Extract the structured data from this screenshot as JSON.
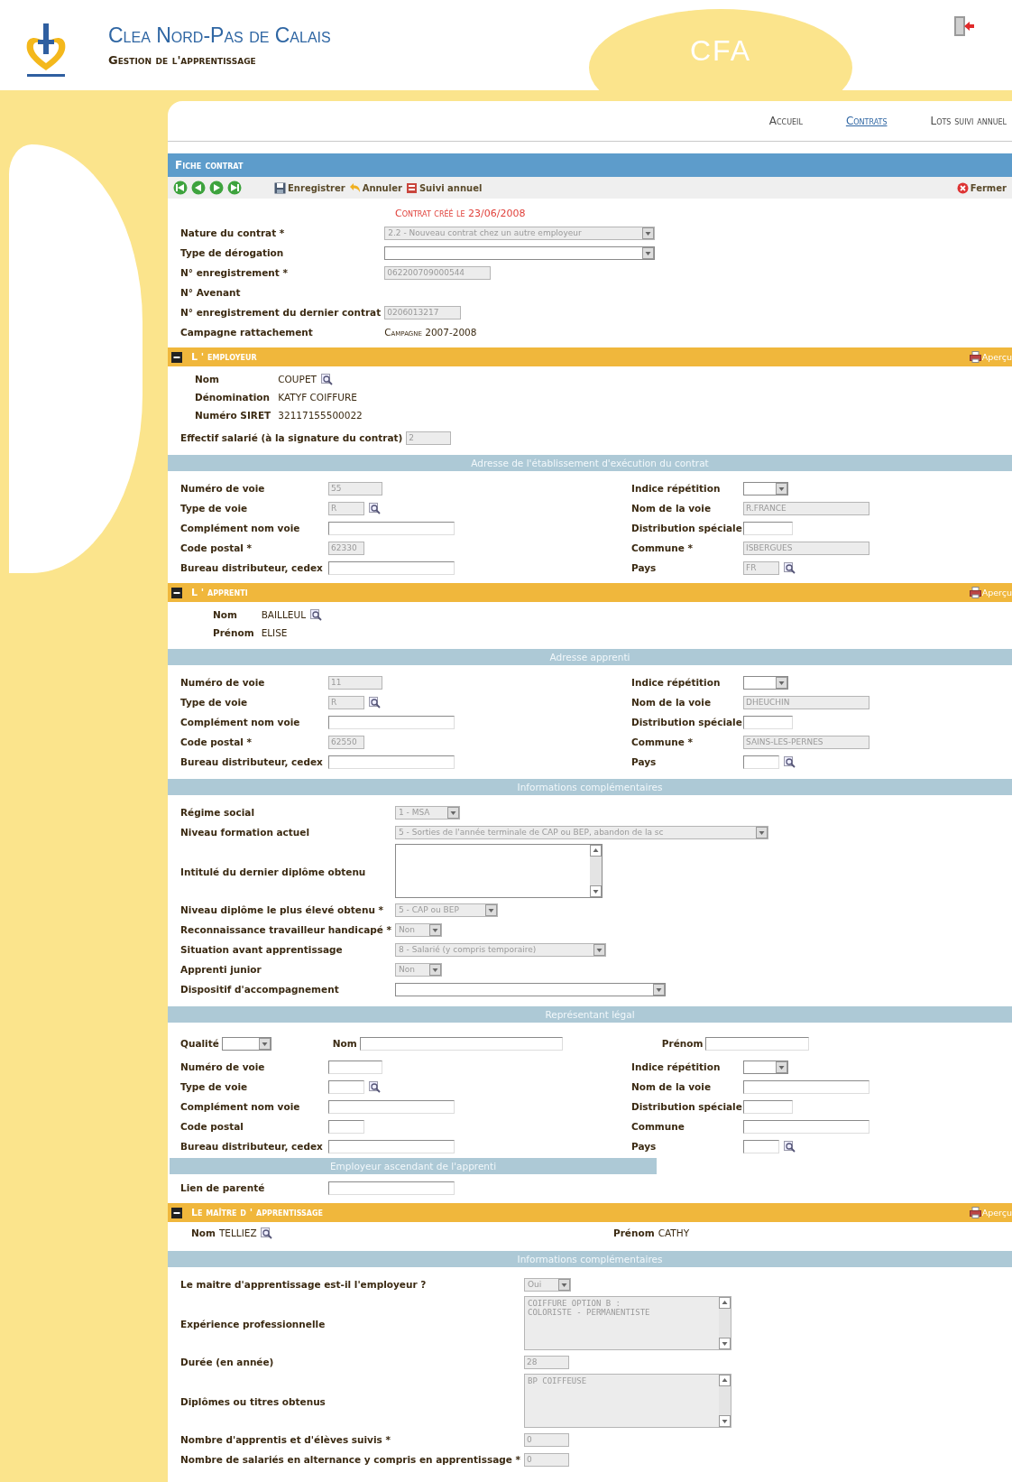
{
  "header": {
    "title": "Clea Nord-Pas de Calais",
    "subtitle": "Gestion de l'apprentissage",
    "space": "CFA"
  },
  "nav": [
    {
      "label": "Accueil",
      "selected": false
    },
    {
      "label": "Contrats",
      "selected": true
    },
    {
      "label": "Lots suivi annuel",
      "selected": false
    }
  ],
  "panel_title": "Fiche contrat",
  "toolbar": {
    "actions": [
      {
        "label": "Enregistrer",
        "kind": "save"
      },
      {
        "label": "Annuler",
        "kind": "undo"
      },
      {
        "label": "Suivi annuel",
        "kind": "report"
      }
    ],
    "close": "Fermer"
  },
  "created_note": "Contrat créé le 23/06/2008",
  "contract_fields": [
    {
      "label": "Nature du contrat *",
      "kind": "select",
      "value": "2.2 - Nouveau contrat chez un autre employeur",
      "disabled": true
    },
    {
      "label": "Type de dérogation",
      "kind": "select",
      "disabled": false
    },
    {
      "label": "N° enregistrement *",
      "kind": "input",
      "value": "062200709000544",
      "disabled": true
    },
    {
      "label": "N° Avenant",
      "kind": "none"
    },
    {
      "label": "N° enregistrement du dernier contrat",
      "kind": "input",
      "value": "0206013217",
      "disabled": true
    },
    {
      "label": "Campagne rattachement",
      "kind": "text",
      "value": "Campagne 2007-2008"
    }
  ],
  "sections": [
    {
      "title": "L ' employeur",
      "preview": "Aperçu",
      "expanded": true,
      "blocks": [
        {
          "kind": "info",
          "items": [
            {
              "label": "Nom",
              "value": "COUPET",
              "lookup": true
            },
            {
              "label": "Dénomination",
              "value": "KATYF COIFFURE"
            },
            {
              "label": "Numéro SIRET",
              "value": "32117155500022"
            }
          ]
        },
        {
          "kind": "fields",
          "items": [
            {
              "label": "Effectif salarié (à la signature du contrat)",
              "kind": "input",
              "value": "2",
              "disabled": true
            }
          ]
        },
        {
          "kind": "subheader",
          "title": "Adresse de l'établissement d'exécution du contrat"
        },
        {
          "kind": "address",
          "left": [
            {
              "label": "Numéro de voie",
              "kind": "input",
              "value": "55",
              "disabled": true
            },
            {
              "label": "Type de voie",
              "kind": "input",
              "value": "R",
              "disabled": true,
              "lookup": true
            },
            {
              "label": "Complément nom voie",
              "kind": "input",
              "disabled": false
            },
            {
              "label": "Code postal *",
              "kind": "input",
              "value": "62330",
              "disabled": true
            },
            {
              "label": "Bureau distributeur, cedex",
              "kind": "input",
              "disabled": false
            }
          ],
          "right": [
            {
              "label": "Indice répétition",
              "kind": "select",
              "disabled": false
            },
            {
              "label": "Nom de la voie",
              "kind": "input",
              "value": "R.FRANCE",
              "disabled": true
            },
            {
              "label": "Distribution spéciale",
              "kind": "input",
              "disabled": false
            },
            {
              "label": "Commune *",
              "kind": "input",
              "value": "ISBERGUES",
              "disabled": true
            },
            {
              "label": "Pays",
              "kind": "input",
              "value": "FR",
              "disabled": true,
              "lookup": true
            }
          ]
        }
      ]
    },
    {
      "title": "L ' apprenti",
      "preview": "Aperçu",
      "expanded": true,
      "blocks": [
        {
          "kind": "info",
          "items": [
            {
              "label": "Nom",
              "value": "BAILLEUL",
              "lookup": true
            },
            {
              "label": "Prénom",
              "value": "ELISE"
            }
          ]
        },
        {
          "kind": "subheader",
          "title": "Adresse apprenti"
        },
        {
          "kind": "address",
          "left": [
            {
              "label": "Numéro de voie",
              "kind": "input",
              "value": "11",
              "disabled": true
            },
            {
              "label": "Type de voie",
              "kind": "input",
              "value": "R",
              "disabled": true,
              "lookup": true
            },
            {
              "label": "Complément nom voie",
              "kind": "input",
              "disabled": false
            },
            {
              "label": "Code postal *",
              "kind": "input",
              "value": "62550",
              "disabled": true
            },
            {
              "label": "Bureau distributeur, cedex",
              "kind": "input",
              "disabled": false
            }
          ],
          "right": [
            {
              "label": "Indice répétition",
              "kind": "select",
              "disabled": false
            },
            {
              "label": "Nom de la voie",
              "kind": "input",
              "value": "DHEUCHIN",
              "disabled": true
            },
            {
              "label": "Distribution spéciale",
              "kind": "input",
              "disabled": false
            },
            {
              "label": "Commune *",
              "kind": "input",
              "value": "SAINS-LES-PERNES",
              "disabled": true
            },
            {
              "label": "Pays",
              "kind": "input",
              "disabled": false,
              "lookup": true
            }
          ]
        },
        {
          "kind": "subheader",
          "title": "Informations complémentaires"
        },
        {
          "kind": "fields",
          "items": [
            {
              "label": "Régime social",
              "kind": "select",
              "value": "1 - MSA",
              "disabled": true
            },
            {
              "label": "Niveau formation actuel",
              "kind": "select",
              "value": "5 - Sorties de l'année terminale de CAP ou BEP, abandon de la sc",
              "disabled": true
            },
            {
              "label": "Intitulé du dernier diplôme obtenu",
              "kind": "textarea",
              "disabled": false
            },
            {
              "label": "Niveau diplôme le plus élevé obtenu *",
              "kind": "select",
              "value": "5 - CAP ou BEP",
              "disabled": true
            },
            {
              "label": "Reconnaissance travailleur handicapé *",
              "kind": "select",
              "value": "Non",
              "disabled": true
            },
            {
              "label": "Situation avant apprentissage",
              "kind": "select",
              "value": "8 - Salarié (y compris temporaire)",
              "disabled": true
            },
            {
              "label": "Apprenti junior",
              "kind": "select",
              "value": "Non",
              "disabled": true
            },
            {
              "label": "Dispositif d'accompagnement",
              "kind": "select",
              "disabled": false
            }
          ]
        },
        {
          "kind": "subheader",
          "title": "Représentant légal"
        },
        {
          "kind": "person_row",
          "items": [
            {
              "label": "Qualité",
              "kind": "select",
              "disabled": false
            },
            {
              "label": "Nom",
              "kind": "input",
              "disabled": false
            },
            {
              "label": "Prénom",
              "kind": "input",
              "disabled": false
            }
          ]
        },
        {
          "kind": "address",
          "left": [
            {
              "label": "Numéro de voie",
              "kind": "input",
              "disabled": false
            },
            {
              "label": "Type de voie",
              "kind": "input",
              "disabled": false,
              "lookup": true
            },
            {
              "label": "Complément nom voie",
              "kind": "input",
              "disabled": false
            },
            {
              "label": "Code postal",
              "kind": "input",
              "disabled": false
            },
            {
              "label": "Bureau distributeur, cedex",
              "kind": "input",
              "disabled": false
            }
          ],
          "right": [
            {
              "label": "Indice répétition",
              "kind": "select",
              "disabled": false
            },
            {
              "label": "Nom de la voie",
              "kind": "input",
              "disabled": false
            },
            {
              "label": "Distribution spéciale",
              "kind": "input",
              "disabled": false
            },
            {
              "label": "Commune",
              "kind": "input",
              "disabled": false
            },
            {
              "label": "Pays",
              "kind": "input",
              "disabled": false,
              "lookup": true
            }
          ]
        },
        {
          "kind": "subheader_half",
          "title": "Employeur ascendant de l'apprenti"
        },
        {
          "kind": "address",
          "left": [
            {
              "label": "Lien de parenté",
              "kind": "input",
              "disabled": false
            }
          ]
        }
      ]
    },
    {
      "title": "Le maître d ' apprentissage",
      "preview": "Aperçu",
      "expanded": true,
      "blocks": [
        {
          "kind": "info_pair",
          "items": [
            {
              "label": "Nom",
              "value": "TELLIEZ",
              "lookup": true
            },
            {
              "label": "Prénom",
              "value": "CATHY"
            }
          ]
        },
        {
          "kind": "subheader",
          "title": "Informations complémentaires"
        },
        {
          "kind": "fields",
          "items": [
            {
              "label": "Le maitre d'apprentissage est-il l'employeur ?",
              "kind": "select",
              "value": "Oui",
              "disabled": true
            },
            {
              "label": "Expérience professionnelle",
              "kind": "textarea",
              "value": "COIFFURE OPTION B :\nCOLORISTE - PERMANENTISTE",
              "disabled": true
            },
            {
              "label": "Durée (en année)",
              "kind": "input",
              "value": "28",
              "disabled": true
            },
            {
              "label": "Diplômes ou titres obtenus",
              "kind": "textarea",
              "value": "BP COIFFEUSE",
              "disabled": true
            },
            {
              "label": "Nombre d'apprentis et d'élèves suivis *",
              "kind": "input",
              "value": "0",
              "disabled": true
            },
            {
              "label": "Nombre de salariés en alternance y compris en apprentissage *",
              "kind": "input",
              "value": "0",
              "disabled": true
            }
          ]
        }
      ]
    }
  ]
}
